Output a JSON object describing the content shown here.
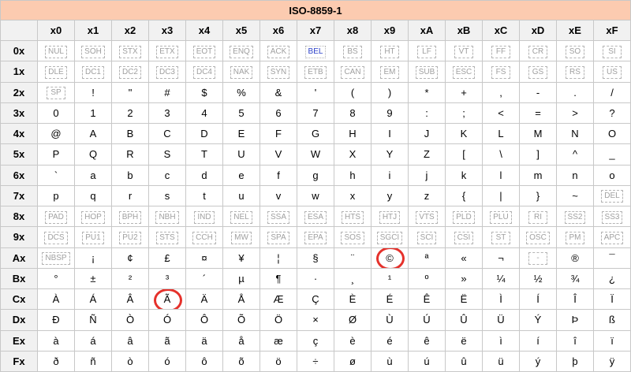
{
  "title": "ISO-8859-1",
  "col_headers": [
    "x0",
    "x1",
    "x2",
    "x3",
    "x4",
    "x5",
    "x6",
    "x7",
    "x8",
    "x9",
    "xA",
    "xB",
    "xC",
    "xD",
    "xE",
    "xF"
  ],
  "rows": [
    {
      "head": "0x",
      "cells": [
        {
          "t": "NUL",
          "c": true
        },
        {
          "t": "SOH",
          "c": true
        },
        {
          "t": "STX",
          "c": true
        },
        {
          "t": "ETX",
          "c": true
        },
        {
          "t": "EOT",
          "c": true
        },
        {
          "t": "ENQ",
          "c": true
        },
        {
          "t": "ACK",
          "c": true
        },
        {
          "t": "BEL",
          "c": true,
          "blue": true
        },
        {
          "t": "BS",
          "c": true
        },
        {
          "t": "HT",
          "c": true
        },
        {
          "t": "LF",
          "c": true
        },
        {
          "t": "VT",
          "c": true
        },
        {
          "t": "FF",
          "c": true
        },
        {
          "t": "CR",
          "c": true
        },
        {
          "t": "SO",
          "c": true
        },
        {
          "t": "SI",
          "c": true
        }
      ]
    },
    {
      "head": "1x",
      "cells": [
        {
          "t": "DLE",
          "c": true
        },
        {
          "t": "DC1",
          "c": true
        },
        {
          "t": "DC2",
          "c": true
        },
        {
          "t": "DC3",
          "c": true
        },
        {
          "t": "DC4",
          "c": true
        },
        {
          "t": "NAK",
          "c": true
        },
        {
          "t": "SYN",
          "c": true
        },
        {
          "t": "ETB",
          "c": true
        },
        {
          "t": "CAN",
          "c": true
        },
        {
          "t": "EM",
          "c": true
        },
        {
          "t": "SUB",
          "c": true
        },
        {
          "t": "ESC",
          "c": true
        },
        {
          "t": "FS",
          "c": true
        },
        {
          "t": "GS",
          "c": true
        },
        {
          "t": "RS",
          "c": true
        },
        {
          "t": "US",
          "c": true
        }
      ]
    },
    {
      "head": "2x",
      "cells": [
        {
          "t": "SP",
          "c": true
        },
        {
          "t": "!"
        },
        {
          "t": "\""
        },
        {
          "t": "#"
        },
        {
          "t": "$"
        },
        {
          "t": "%"
        },
        {
          "t": "&"
        },
        {
          "t": "'"
        },
        {
          "t": "("
        },
        {
          "t": ")"
        },
        {
          "t": "*"
        },
        {
          "t": "+"
        },
        {
          "t": ","
        },
        {
          "t": "-"
        },
        {
          "t": "."
        },
        {
          "t": "/"
        }
      ]
    },
    {
      "head": "3x",
      "cells": [
        {
          "t": "0"
        },
        {
          "t": "1"
        },
        {
          "t": "2"
        },
        {
          "t": "3"
        },
        {
          "t": "4"
        },
        {
          "t": "5"
        },
        {
          "t": "6"
        },
        {
          "t": "7"
        },
        {
          "t": "8"
        },
        {
          "t": "9"
        },
        {
          "t": ":"
        },
        {
          "t": ";"
        },
        {
          "t": "<"
        },
        {
          "t": "="
        },
        {
          "t": ">"
        },
        {
          "t": "?"
        }
      ]
    },
    {
      "head": "4x",
      "cells": [
        {
          "t": "@"
        },
        {
          "t": "A"
        },
        {
          "t": "B"
        },
        {
          "t": "C"
        },
        {
          "t": "D"
        },
        {
          "t": "E"
        },
        {
          "t": "F"
        },
        {
          "t": "G"
        },
        {
          "t": "H"
        },
        {
          "t": "I"
        },
        {
          "t": "J"
        },
        {
          "t": "K"
        },
        {
          "t": "L"
        },
        {
          "t": "M"
        },
        {
          "t": "N"
        },
        {
          "t": "O"
        }
      ]
    },
    {
      "head": "5x",
      "cells": [
        {
          "t": "P"
        },
        {
          "t": "Q"
        },
        {
          "t": "R"
        },
        {
          "t": "S"
        },
        {
          "t": "T"
        },
        {
          "t": "U"
        },
        {
          "t": "V"
        },
        {
          "t": "W"
        },
        {
          "t": "X"
        },
        {
          "t": "Y"
        },
        {
          "t": "Z"
        },
        {
          "t": "["
        },
        {
          "t": "\\"
        },
        {
          "t": "]"
        },
        {
          "t": "^"
        },
        {
          "t": "_"
        }
      ]
    },
    {
      "head": "6x",
      "cells": [
        {
          "t": "`"
        },
        {
          "t": "a"
        },
        {
          "t": "b"
        },
        {
          "t": "c"
        },
        {
          "t": "d"
        },
        {
          "t": "e"
        },
        {
          "t": "f"
        },
        {
          "t": "g"
        },
        {
          "t": "h"
        },
        {
          "t": "i"
        },
        {
          "t": "j"
        },
        {
          "t": "k"
        },
        {
          "t": "l"
        },
        {
          "t": "m"
        },
        {
          "t": "n"
        },
        {
          "t": "o"
        }
      ]
    },
    {
      "head": "7x",
      "cells": [
        {
          "t": "p"
        },
        {
          "t": "q"
        },
        {
          "t": "r"
        },
        {
          "t": "s"
        },
        {
          "t": "t"
        },
        {
          "t": "u"
        },
        {
          "t": "v"
        },
        {
          "t": "w"
        },
        {
          "t": "x"
        },
        {
          "t": "y"
        },
        {
          "t": "z"
        },
        {
          "t": "{"
        },
        {
          "t": "|"
        },
        {
          "t": "}"
        },
        {
          "t": "~"
        },
        {
          "t": "DEL",
          "c": true
        }
      ]
    },
    {
      "head": "8x",
      "cells": [
        {
          "t": "PAD",
          "c": true
        },
        {
          "t": "HOP",
          "c": true
        },
        {
          "t": "BPH",
          "c": true
        },
        {
          "t": "NBH",
          "c": true
        },
        {
          "t": "IND",
          "c": true
        },
        {
          "t": "NEL",
          "c": true
        },
        {
          "t": "SSA",
          "c": true
        },
        {
          "t": "ESA",
          "c": true
        },
        {
          "t": "HTS",
          "c": true
        },
        {
          "t": "HTJ",
          "c": true
        },
        {
          "t": "VTS",
          "c": true
        },
        {
          "t": "PLD",
          "c": true
        },
        {
          "t": "PLU",
          "c": true
        },
        {
          "t": "RI",
          "c": true
        },
        {
          "t": "SS2",
          "c": true
        },
        {
          "t": "SS3",
          "c": true
        }
      ]
    },
    {
      "head": "9x",
      "cells": [
        {
          "t": "DCS",
          "c": true
        },
        {
          "t": "PU1",
          "c": true
        },
        {
          "t": "PU2",
          "c": true
        },
        {
          "t": "STS",
          "c": true
        },
        {
          "t": "CCH",
          "c": true
        },
        {
          "t": "MW",
          "c": true
        },
        {
          "t": "SPA",
          "c": true
        },
        {
          "t": "EPA",
          "c": true
        },
        {
          "t": "SOS",
          "c": true
        },
        {
          "t": "SGCI",
          "c": true
        },
        {
          "t": "SCI",
          "c": true
        },
        {
          "t": "CSI",
          "c": true
        },
        {
          "t": "ST",
          "c": true
        },
        {
          "t": "OSC",
          "c": true
        },
        {
          "t": "PM",
          "c": true
        },
        {
          "t": "APC",
          "c": true
        }
      ]
    },
    {
      "head": "Ax",
      "cells": [
        {
          "t": "NBSP",
          "c": true
        },
        {
          "t": "¡"
        },
        {
          "t": "¢"
        },
        {
          "t": "£"
        },
        {
          "t": "¤"
        },
        {
          "t": "¥"
        },
        {
          "t": "¦"
        },
        {
          "t": "§"
        },
        {
          "t": "¨"
        },
        {
          "t": "©",
          "circled": true
        },
        {
          "t": "ª"
        },
        {
          "t": "«"
        },
        {
          "t": "¬"
        },
        {
          "t": "-",
          "c": true
        },
        {
          "t": "®"
        },
        {
          "t": "¯"
        }
      ]
    },
    {
      "head": "Bx",
      "cells": [
        {
          "t": "°"
        },
        {
          "t": "±"
        },
        {
          "t": "²"
        },
        {
          "t": "³"
        },
        {
          "t": "´"
        },
        {
          "t": "µ"
        },
        {
          "t": "¶"
        },
        {
          "t": "·"
        },
        {
          "t": "¸"
        },
        {
          "t": "¹"
        },
        {
          "t": "º"
        },
        {
          "t": "»"
        },
        {
          "t": "¼"
        },
        {
          "t": "½"
        },
        {
          "t": "¾"
        },
        {
          "t": "¿"
        }
      ]
    },
    {
      "head": "Cx",
      "cells": [
        {
          "t": "À"
        },
        {
          "t": "Á"
        },
        {
          "t": "Â"
        },
        {
          "t": "Ã",
          "circled": true
        },
        {
          "t": "Ä"
        },
        {
          "t": "Å"
        },
        {
          "t": "Æ"
        },
        {
          "t": "Ç"
        },
        {
          "t": "È"
        },
        {
          "t": "É"
        },
        {
          "t": "Ê"
        },
        {
          "t": "Ë"
        },
        {
          "t": "Ì"
        },
        {
          "t": "Í"
        },
        {
          "t": "Î"
        },
        {
          "t": "Ï"
        }
      ]
    },
    {
      "head": "Dx",
      "cells": [
        {
          "t": "Ð"
        },
        {
          "t": "Ñ"
        },
        {
          "t": "Ò"
        },
        {
          "t": "Ó"
        },
        {
          "t": "Ô"
        },
        {
          "t": "Õ"
        },
        {
          "t": "Ö"
        },
        {
          "t": "×"
        },
        {
          "t": "Ø"
        },
        {
          "t": "Ù"
        },
        {
          "t": "Ú"
        },
        {
          "t": "Û"
        },
        {
          "t": "Ü"
        },
        {
          "t": "Ý"
        },
        {
          "t": "Þ"
        },
        {
          "t": "ß"
        }
      ]
    },
    {
      "head": "Ex",
      "cells": [
        {
          "t": "à"
        },
        {
          "t": "á"
        },
        {
          "t": "â"
        },
        {
          "t": "ã"
        },
        {
          "t": "ä"
        },
        {
          "t": "å"
        },
        {
          "t": "æ"
        },
        {
          "t": "ç"
        },
        {
          "t": "è"
        },
        {
          "t": "é"
        },
        {
          "t": "ê"
        },
        {
          "t": "ë"
        },
        {
          "t": "ì"
        },
        {
          "t": "í"
        },
        {
          "t": "î"
        },
        {
          "t": "ï"
        }
      ]
    },
    {
      "head": "Fx",
      "cells": [
        {
          "t": "ð"
        },
        {
          "t": "ñ"
        },
        {
          "t": "ò"
        },
        {
          "t": "ó"
        },
        {
          "t": "ô"
        },
        {
          "t": "õ"
        },
        {
          "t": "ö"
        },
        {
          "t": "÷"
        },
        {
          "t": "ø"
        },
        {
          "t": "ù"
        },
        {
          "t": "ú"
        },
        {
          "t": "û"
        },
        {
          "t": "ü"
        },
        {
          "t": "ý"
        },
        {
          "t": "þ"
        },
        {
          "t": "ÿ"
        }
      ]
    }
  ]
}
